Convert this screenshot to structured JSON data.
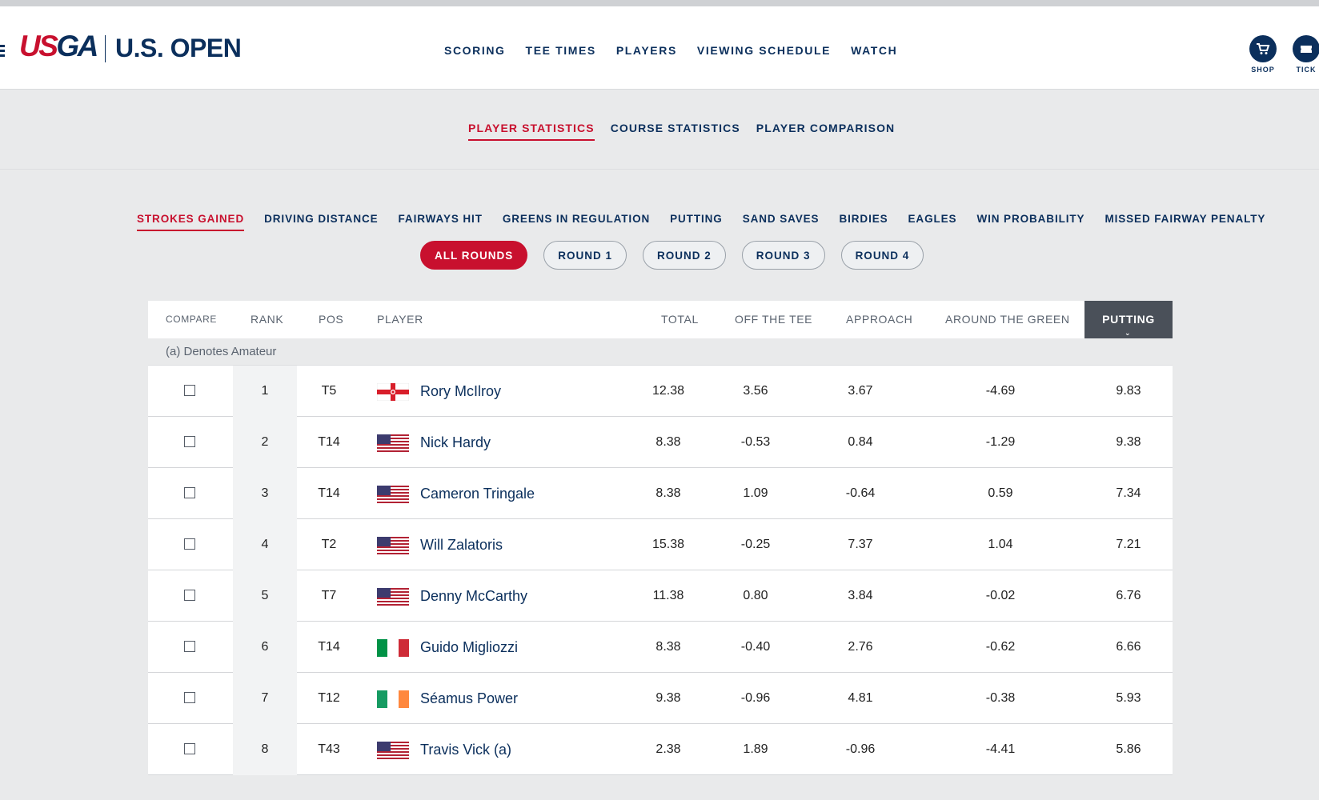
{
  "header": {
    "logo_usga_us": "US",
    "logo_usga_ga": "GA",
    "logo_open": "U.S. OPEN",
    "nav": [
      "SCORING",
      "TEE TIMES",
      "PLAYERS",
      "VIEWING SCHEDULE",
      "WATCH"
    ],
    "shop_label": "SHOP",
    "tickets_label": "TICK"
  },
  "subnav": {
    "tabs": [
      "PLAYER STATISTICS",
      "COURSE STATISTICS",
      "PLAYER COMPARISON"
    ],
    "active": "PLAYER STATISTICS"
  },
  "stat_tabs": {
    "items": [
      "STROKES GAINED",
      "DRIVING DISTANCE",
      "FAIRWAYS HIT",
      "GREENS IN REGULATION",
      "PUTTING",
      "SAND SAVES",
      "BIRDIES",
      "EAGLES",
      "WIN PROBABILITY",
      "MISSED FAIRWAY PENALTY"
    ],
    "active": "STROKES GAINED"
  },
  "rounds": {
    "items": [
      "ALL ROUNDS",
      "ROUND 1",
      "ROUND 2",
      "ROUND 3",
      "ROUND 4"
    ],
    "active": "ALL ROUNDS"
  },
  "table": {
    "columns": {
      "compare": "COMPARE",
      "rank": "RANK",
      "pos": "POS",
      "player": "PLAYER",
      "total": "TOTAL",
      "off_the_tee": "OFF THE TEE",
      "approach": "APPROACH",
      "around_the_green": "AROUND THE GREEN",
      "putting": "PUTTING"
    },
    "sorted_by": "PUTTING",
    "note": "(a) Denotes Amateur",
    "rows": [
      {
        "rank": "1",
        "pos": "T5",
        "player": "Rory McIlroy",
        "flag": "northern-ireland",
        "total": "12.38",
        "off_the_tee": "3.56",
        "approach": "3.67",
        "around_the_green": "-4.69",
        "putting": "9.83"
      },
      {
        "rank": "2",
        "pos": "T14",
        "player": "Nick Hardy",
        "flag": "usa",
        "total": "8.38",
        "off_the_tee": "-0.53",
        "approach": "0.84",
        "around_the_green": "-1.29",
        "putting": "9.38"
      },
      {
        "rank": "3",
        "pos": "T14",
        "player": "Cameron Tringale",
        "flag": "usa",
        "total": "8.38",
        "off_the_tee": "1.09",
        "approach": "-0.64",
        "around_the_green": "0.59",
        "putting": "7.34"
      },
      {
        "rank": "4",
        "pos": "T2",
        "player": "Will Zalatoris",
        "flag": "usa",
        "total": "15.38",
        "off_the_tee": "-0.25",
        "approach": "7.37",
        "around_the_green": "1.04",
        "putting": "7.21"
      },
      {
        "rank": "5",
        "pos": "T7",
        "player": "Denny McCarthy",
        "flag": "usa",
        "total": "11.38",
        "off_the_tee": "0.80",
        "approach": "3.84",
        "around_the_green": "-0.02",
        "putting": "6.76"
      },
      {
        "rank": "6",
        "pos": "T14",
        "player": "Guido Migliozzi",
        "flag": "italy",
        "total": "8.38",
        "off_the_tee": "-0.40",
        "approach": "2.76",
        "around_the_green": "-0.62",
        "putting": "6.66"
      },
      {
        "rank": "7",
        "pos": "T12",
        "player": "Séamus Power",
        "flag": "ireland",
        "total": "9.38",
        "off_the_tee": "-0.96",
        "approach": "4.81",
        "around_the_green": "-0.38",
        "putting": "5.93"
      },
      {
        "rank": "8",
        "pos": "T43",
        "player": "Travis Vick (a)",
        "flag": "usa",
        "total": "2.38",
        "off_the_tee": "1.89",
        "approach": "-0.96",
        "around_the_green": "-4.41",
        "putting": "5.86"
      }
    ]
  },
  "colors": {
    "navy": "#0b2f5c",
    "usga_red": "#c8102e",
    "sorted_header": "#4a5059",
    "page_bg": "#e9eaeb"
  }
}
